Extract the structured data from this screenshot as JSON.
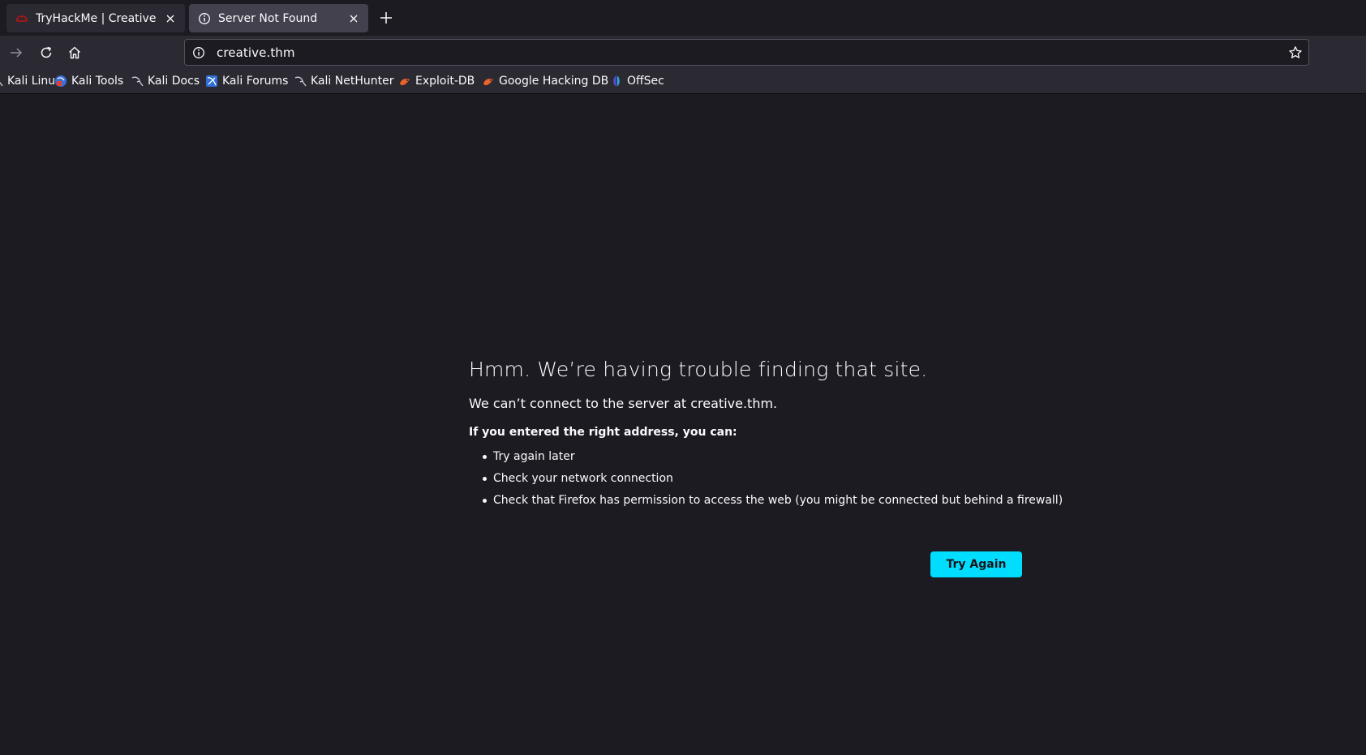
{
  "tabs": [
    {
      "title": "TryHackMe | Creative",
      "icon": "tryhackme-logo-icon",
      "active": false
    },
    {
      "title": "Server Not Found",
      "icon": "info-icon",
      "active": true
    }
  ],
  "navbar": {
    "url": "creative.thm"
  },
  "bookmarks": [
    {
      "label": "Kali Linux",
      "icon": "kali-dragon-icon"
    },
    {
      "label": "Kali Tools",
      "icon": "kali-tools-icon"
    },
    {
      "label": "Kali Docs",
      "icon": "kali-dragon-icon"
    },
    {
      "label": "Kali Forums",
      "icon": "kali-forums-icon"
    },
    {
      "label": "Kali NetHunter",
      "icon": "kali-dragon-icon"
    },
    {
      "label": "Exploit-DB",
      "icon": "exploit-db-icon"
    },
    {
      "label": "Google Hacking DB",
      "icon": "exploit-db-icon"
    },
    {
      "label": "OffSec",
      "icon": "offsec-icon"
    }
  ],
  "error_page": {
    "title": "Hmm. We’re having trouble finding that site.",
    "description": "We can’t connect to the server at creative.thm.",
    "subheading": "If you entered the right address, you can:",
    "suggestions": [
      "Try again later",
      "Check your network connection",
      "Check that Firefox has permission to access the web (you might be connected but behind a firewall)"
    ],
    "button_label": "Try Again"
  },
  "colors": {
    "page_background": "#1c1b22",
    "toolbar_background": "#2b2a33",
    "active_tab": "#42414d",
    "accent_button": "#00ddff"
  }
}
